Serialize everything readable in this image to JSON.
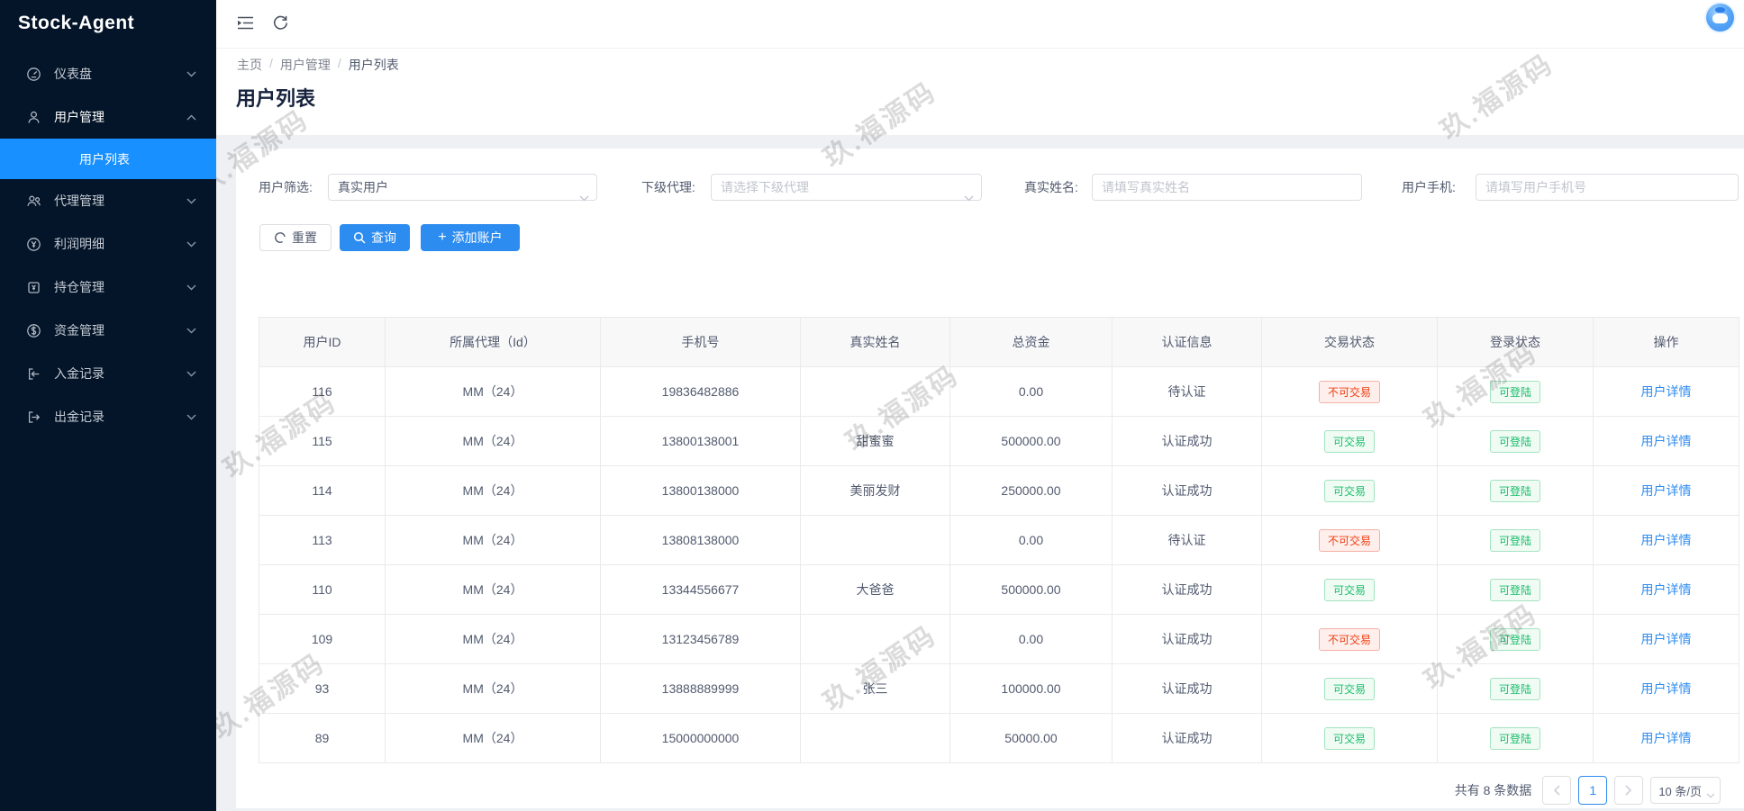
{
  "app": {
    "title": "Stock-Agent"
  },
  "topbar": {
    "icons": [
      "collapse-menu-icon",
      "refresh-icon"
    ],
    "avatar": "user-avatar"
  },
  "sidebar": {
    "items": [
      {
        "label": "仪表盘",
        "icon": "dashboard-icon"
      },
      {
        "label": "用户管理",
        "icon": "users-icon",
        "expanded": true,
        "children": [
          {
            "label": "用户列表",
            "active": true
          }
        ]
      },
      {
        "label": "代理管理",
        "icon": "agents-icon"
      },
      {
        "label": "利润明细",
        "icon": "profit-icon"
      },
      {
        "label": "持仓管理",
        "icon": "positions-icon"
      },
      {
        "label": "资金管理",
        "icon": "funds-icon"
      },
      {
        "label": "入金记录",
        "icon": "deposit-icon"
      },
      {
        "label": "出金记录",
        "icon": "withdraw-icon"
      }
    ]
  },
  "breadcrumb": {
    "items": [
      "主页",
      "用户管理",
      "用户列表"
    ]
  },
  "page": {
    "title": "用户列表"
  },
  "filters": {
    "user_filter": {
      "label": "用户筛选:",
      "value": "真实用户"
    },
    "sub_agent": {
      "label": "下级代理:",
      "placeholder": "请选择下级代理"
    },
    "real_name": {
      "label": "真实姓名:",
      "placeholder": "请填写真实姓名"
    },
    "user_phone": {
      "label": "用户手机:",
      "placeholder": "请填写用户手机号"
    }
  },
  "actions": {
    "reset": "重置",
    "search": "查询",
    "add": "添加账户"
  },
  "table": {
    "columns": [
      "用户ID",
      "所属代理（Id）",
      "手机号",
      "真实姓名",
      "总资金",
      "认证信息",
      "交易状态",
      "登录状态",
      "操作"
    ],
    "rows": [
      {
        "user_id": "116",
        "agent": "MM（24）",
        "phone": "19836482886",
        "real_name": "",
        "total_funds": "0.00",
        "auth_status": "待认证",
        "trade_status": "不可交易",
        "trade_state": "danger",
        "login_status": "可登陆",
        "login_state": "success",
        "action": "用户详情"
      },
      {
        "user_id": "115",
        "agent": "MM（24）",
        "phone": "13800138001",
        "real_name": "甜蜜蜜",
        "total_funds": "500000.00",
        "auth_status": "认证成功",
        "trade_status": "可交易",
        "trade_state": "success",
        "login_status": "可登陆",
        "login_state": "success",
        "action": "用户详情"
      },
      {
        "user_id": "114",
        "agent": "MM（24）",
        "phone": "13800138000",
        "real_name": "美丽发财",
        "total_funds": "250000.00",
        "auth_status": "认证成功",
        "trade_status": "可交易",
        "trade_state": "success",
        "login_status": "可登陆",
        "login_state": "success",
        "action": "用户详情"
      },
      {
        "user_id": "113",
        "agent": "MM（24）",
        "phone": "13808138000",
        "real_name": "",
        "total_funds": "0.00",
        "auth_status": "待认证",
        "trade_status": "不可交易",
        "trade_state": "danger",
        "login_status": "可登陆",
        "login_state": "success",
        "action": "用户详情"
      },
      {
        "user_id": "110",
        "agent": "MM（24）",
        "phone": "13344556677",
        "real_name": "大爸爸",
        "total_funds": "500000.00",
        "auth_status": "认证成功",
        "trade_status": "可交易",
        "trade_state": "success",
        "login_status": "可登陆",
        "login_state": "success",
        "action": "用户详情"
      },
      {
        "user_id": "109",
        "agent": "MM（24）",
        "phone": "13123456789",
        "real_name": "",
        "total_funds": "0.00",
        "auth_status": "认证成功",
        "trade_status": "不可交易",
        "trade_state": "danger",
        "login_status": "可登陆",
        "login_state": "success",
        "action": "用户详情"
      },
      {
        "user_id": "93",
        "agent": "MM（24）",
        "phone": "13888889999",
        "real_name": "张三",
        "total_funds": "100000.00",
        "auth_status": "认证成功",
        "trade_status": "可交易",
        "trade_state": "success",
        "login_status": "可登陆",
        "login_state": "success",
        "action": "用户详情"
      },
      {
        "user_id": "89",
        "agent": "MM（24）",
        "phone": "15000000000",
        "real_name": "",
        "total_funds": "50000.00",
        "auth_status": "认证成功",
        "trade_status": "可交易",
        "trade_state": "success",
        "login_status": "可登陆",
        "login_state": "success",
        "action": "用户详情"
      }
    ]
  },
  "footer": {
    "total": "共有 8 条数据",
    "current_page": "1",
    "page_size": "10 条/页"
  },
  "watermark": {
    "text": "玖.福源码"
  },
  "colors": {
    "primary": "#2d8cf0",
    "sidebar_active": "#1890ff",
    "success": "#19be6b",
    "danger": "#ed4014",
    "sidebar_bg": "#041529"
  }
}
